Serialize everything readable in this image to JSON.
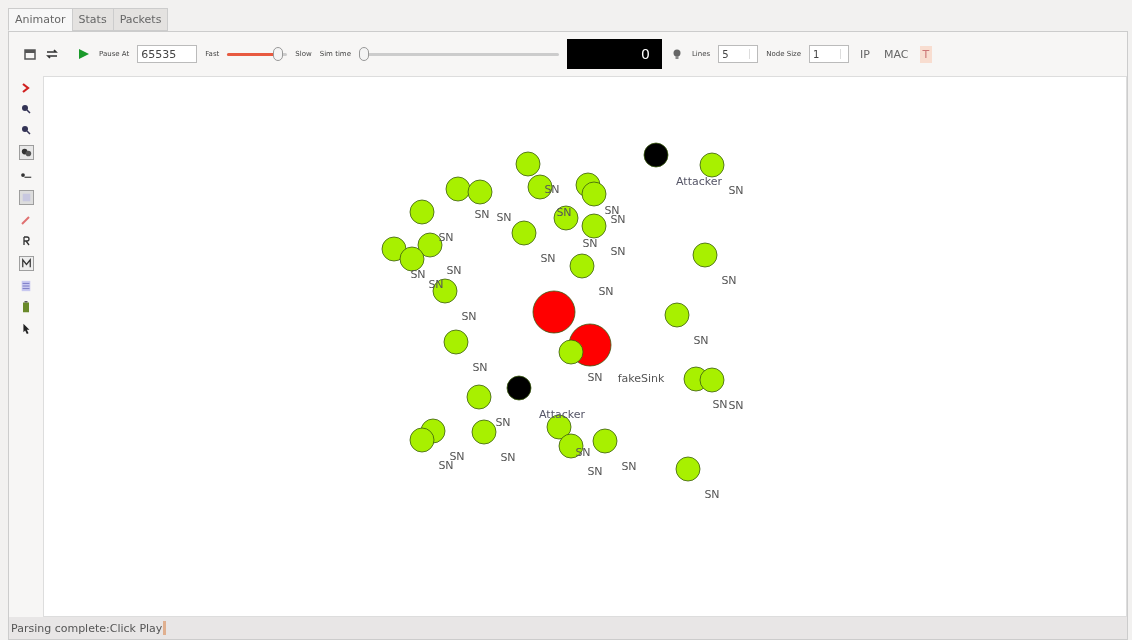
{
  "tabs": [
    {
      "label": "Animator",
      "selected": true
    },
    {
      "label": "Stats",
      "selected": false
    },
    {
      "label": "Packets",
      "selected": false
    }
  ],
  "toolbar": {
    "pause_at_label": "Pause At",
    "pause_at_value": "65535",
    "fast_label": "Fast",
    "speed": {
      "level": 0.85
    },
    "slow_label": "Slow",
    "sim_time_label": "Sim time",
    "sim_time": {
      "level": 0
    },
    "time_display": "0",
    "lines_label": "Lines",
    "lines_value": "5",
    "node_size_label": "Node Size",
    "node_size_value": "1",
    "ip_label": "IP",
    "mac_label": "MAC",
    "t_label": "T",
    "t_on": true
  },
  "nodes": [
    {
      "kind": "sensor",
      "label": "SN"
    },
    {
      "kind": "sensor",
      "label": "SN"
    },
    {
      "kind": "sensor",
      "label": "SN"
    },
    {
      "kind": "sensor",
      "label": "SN"
    },
    {
      "kind": "sensor",
      "label": "SN"
    },
    {
      "kind": "sensor",
      "label": "SN"
    },
    {
      "kind": "sensor",
      "label": "SN"
    },
    {
      "kind": "sensor",
      "label": "SN"
    },
    {
      "kind": "sensor",
      "label": "SN"
    },
    {
      "kind": "sensor",
      "label": "SN"
    },
    {
      "kind": "sensor",
      "label": "SN"
    },
    {
      "kind": "sensor",
      "label": "SN"
    },
    {
      "kind": "sensor",
      "label": "SN"
    },
    {
      "kind": "sensor",
      "label": "SN"
    },
    {
      "kind": "sensor",
      "label": "SN"
    },
    {
      "kind": "sensor",
      "label": "SN"
    },
    {
      "kind": "sensor",
      "label": "SN"
    },
    {
      "kind": "sensor",
      "label": "SN"
    },
    {
      "kind": "sink"
    },
    {
      "kind": "sink",
      "label": "fakeSink"
    },
    {
      "kind": "attacker",
      "label": "Attacker"
    },
    {
      "kind": "attacker",
      "label": "Attacker"
    },
    {
      "kind": "sensor",
      "label": "SN"
    },
    {
      "kind": "sensor",
      "label": "SN"
    },
    {
      "kind": "sensor",
      "label": "SN"
    },
    {
      "kind": "sensor",
      "label": "SN"
    },
    {
      "kind": "sensor",
      "label": "SN"
    },
    {
      "kind": "sensor",
      "label": "SN"
    },
    {
      "kind": "sensor",
      "label": "SN"
    },
    {
      "kind": "sensor",
      "label": "SN"
    },
    {
      "kind": "sensor",
      "label": "SN"
    },
    {
      "kind": "sensor",
      "label": "SN"
    },
    {
      "kind": "sensor",
      "label": "SN"
    },
    {
      "kind": "sensor",
      "label": "SN"
    }
  ],
  "status_bar": "Parsing complete:Click Play"
}
